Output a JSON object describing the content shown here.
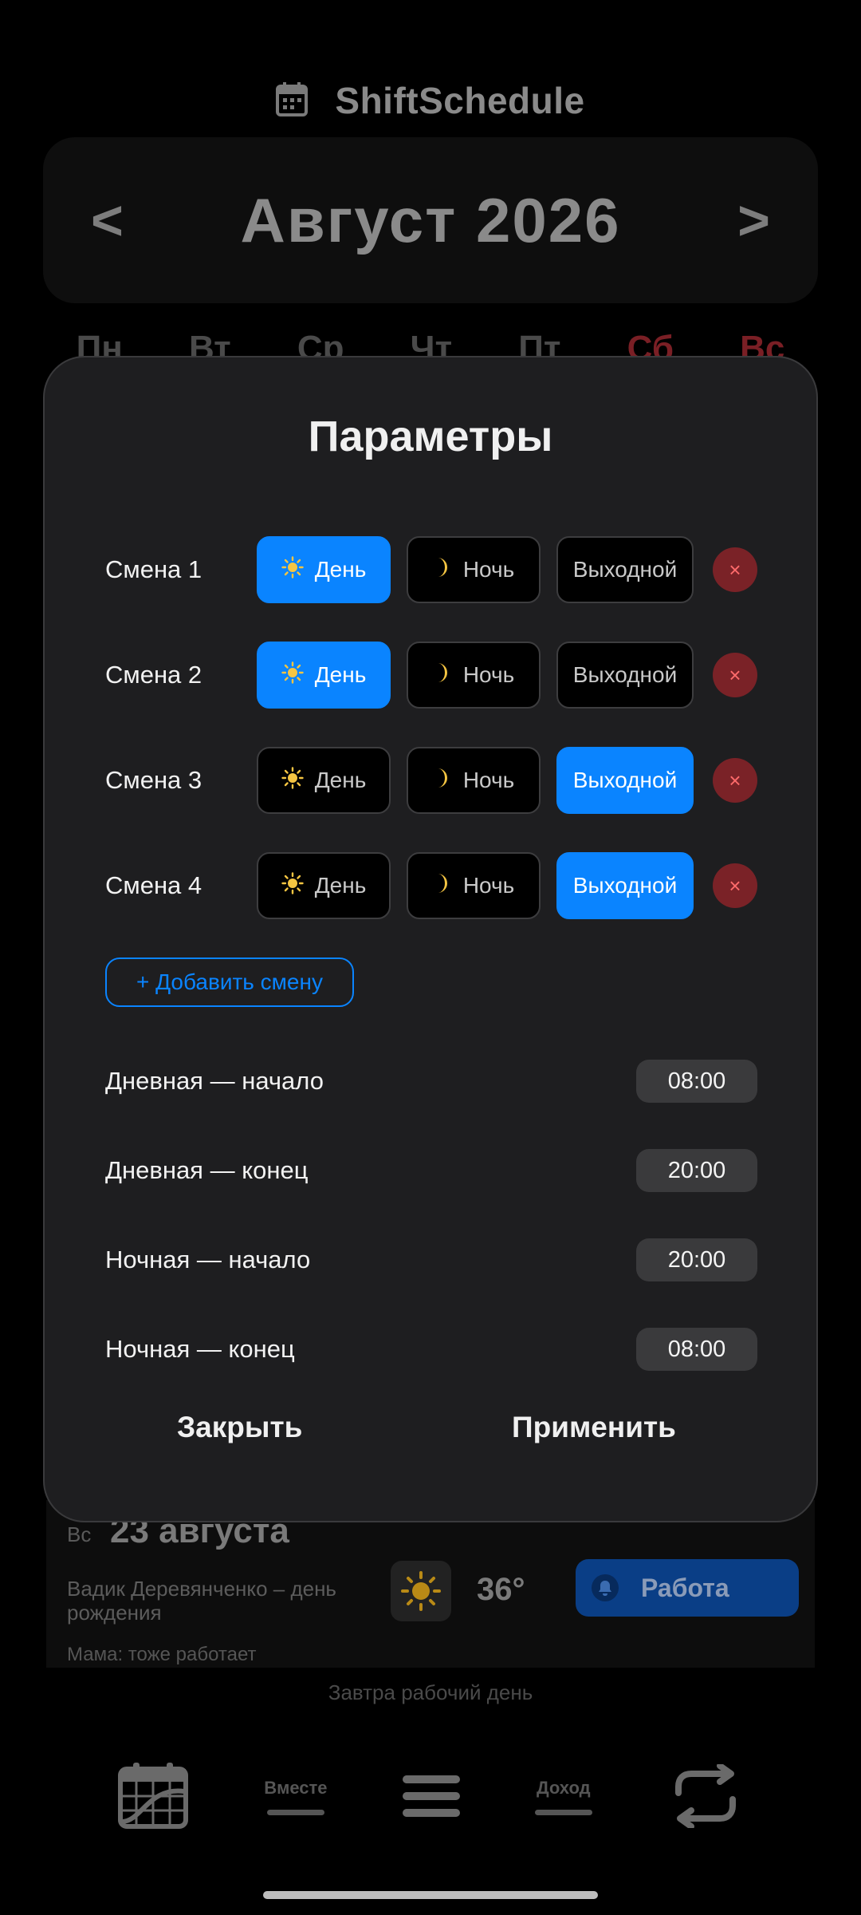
{
  "app": {
    "title": "ShiftSchedule"
  },
  "calendar": {
    "prev": "<",
    "next": ">",
    "month_label": "Август 2026",
    "weekdays": [
      "Пн",
      "Вт",
      "Ср",
      "Чт",
      "Пт",
      "Сб",
      "Вс"
    ]
  },
  "day_card": {
    "weekday": "Вс",
    "date": "23 августа",
    "event": "Вадик Деревянченко – день рождения",
    "note": "Мама: тоже работает",
    "temperature": "36°",
    "status_button": "Работа"
  },
  "tomorrow_text": "Завтра рабочий день",
  "bottom_nav": {
    "together": "Вместе",
    "income": "Доход"
  },
  "modal": {
    "title": "Параметры",
    "shift_options": {
      "day": "День",
      "night": "Ночь",
      "off": "Выходной"
    },
    "remove_symbol": "×",
    "shifts": [
      {
        "label": "Смена 1",
        "selected": "day"
      },
      {
        "label": "Смена 2",
        "selected": "day"
      },
      {
        "label": "Смена 3",
        "selected": "off"
      },
      {
        "label": "Смена 4",
        "selected": "off"
      }
    ],
    "add_shift": "+ Добавить смену",
    "times": {
      "day_start": {
        "label": "Дневная — начало",
        "value": "08:00"
      },
      "day_end": {
        "label": "Дневная — конец",
        "value": "20:00"
      },
      "night_start": {
        "label": "Ночная — начало",
        "value": "20:00"
      },
      "night_end": {
        "label": "Ночная — конец",
        "value": "08:00"
      }
    },
    "close": "Закрыть",
    "apply": "Применить"
  },
  "colors": {
    "accent": "#0a84ff",
    "remove": "#7a2227",
    "modal_bg": "#1e1e20",
    "sun": "#f5c542"
  }
}
